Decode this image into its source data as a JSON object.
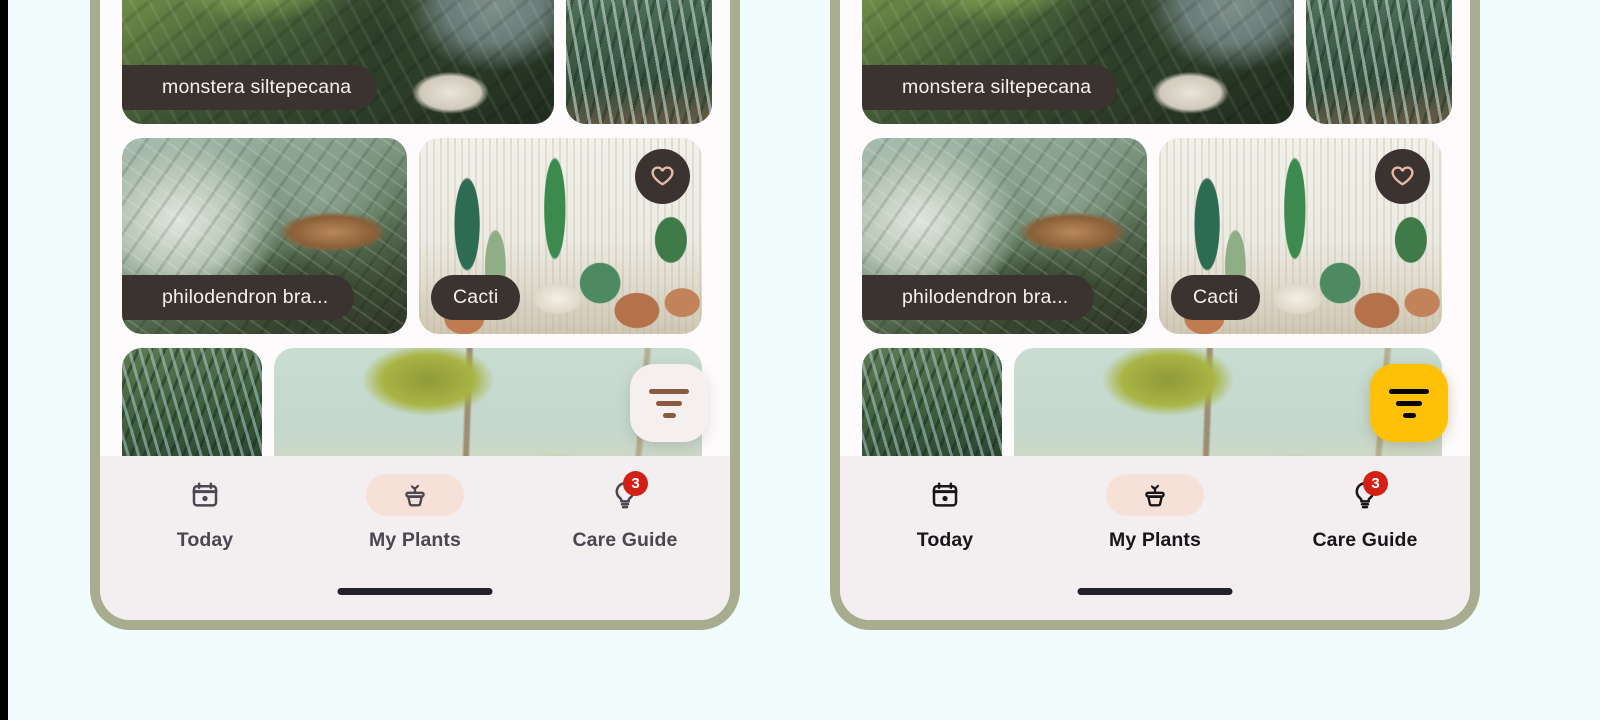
{
  "background_color": "#f1fcfd",
  "frame_color": "#a7ad8e",
  "screen_color": "#fdfbfc",
  "nav_bar_color": "#f3eeef",
  "chip_color": "#3b3330",
  "badge_color": "#d32017",
  "accent_amber": "#ffc107",
  "accent_pink": "#f6e1d9",
  "heart_color": "#e8b8a6",
  "phones": [
    {
      "id": "left-phone",
      "variant": "light-fab",
      "fab": {
        "name": "filter-fab",
        "icon": "filter-icon",
        "background": "#f5efef",
        "icon_color": "#8a5a40"
      },
      "bottom_nav": {
        "items": [
          {
            "label": "Today",
            "icon": "calendar-icon",
            "active": false,
            "badge": null
          },
          {
            "label": "My Plants",
            "icon": "potted-plant-icon",
            "active": true,
            "badge": null
          },
          {
            "label": "Care Guide",
            "icon": "lightbulb-icon",
            "active": false,
            "badge": "3"
          }
        ]
      },
      "tiles": [
        {
          "label": "monstera siltepecana",
          "chip": "edge",
          "favorite": false,
          "photo": "monstera-photo"
        },
        {
          "label": null,
          "chip": null,
          "favorite": false,
          "photo": "fern-photo"
        },
        {
          "label": "philodendron bra...",
          "chip": "edge",
          "favorite": false,
          "photo": "philodendron-photo"
        },
        {
          "label": "Cacti",
          "chip": "small",
          "favorite": true,
          "photo": "cacti-photo"
        },
        {
          "label": null,
          "chip": null,
          "favorite": false,
          "photo": "palm-photo"
        },
        {
          "label": null,
          "chip": null,
          "favorite": false,
          "photo": "yellow-leaf-photo"
        }
      ]
    },
    {
      "id": "right-phone",
      "variant": "amber-fab",
      "fab": {
        "name": "filter-fab",
        "icon": "filter-icon",
        "background": "#ffc107",
        "icon_color": "#000000"
      },
      "bottom_nav": {
        "items": [
          {
            "label": "Today",
            "icon": "calendar-icon",
            "active": false,
            "badge": null
          },
          {
            "label": "My Plants",
            "icon": "potted-plant-icon",
            "active": true,
            "badge": null
          },
          {
            "label": "Care Guide",
            "icon": "lightbulb-icon",
            "active": false,
            "badge": "3"
          }
        ]
      },
      "tiles": [
        {
          "label": "monstera siltepecana",
          "chip": "edge",
          "favorite": false,
          "photo": "monstera-photo"
        },
        {
          "label": null,
          "chip": null,
          "favorite": false,
          "photo": "fern-photo"
        },
        {
          "label": "philodendron bra...",
          "chip": "edge",
          "favorite": false,
          "photo": "philodendron-photo"
        },
        {
          "label": "Cacti",
          "chip": "small",
          "favorite": true,
          "photo": "cacti-photo"
        },
        {
          "label": null,
          "chip": null,
          "favorite": false,
          "photo": "palm-photo"
        },
        {
          "label": null,
          "chip": null,
          "favorite": false,
          "photo": "yellow-leaf-photo"
        }
      ]
    }
  ]
}
